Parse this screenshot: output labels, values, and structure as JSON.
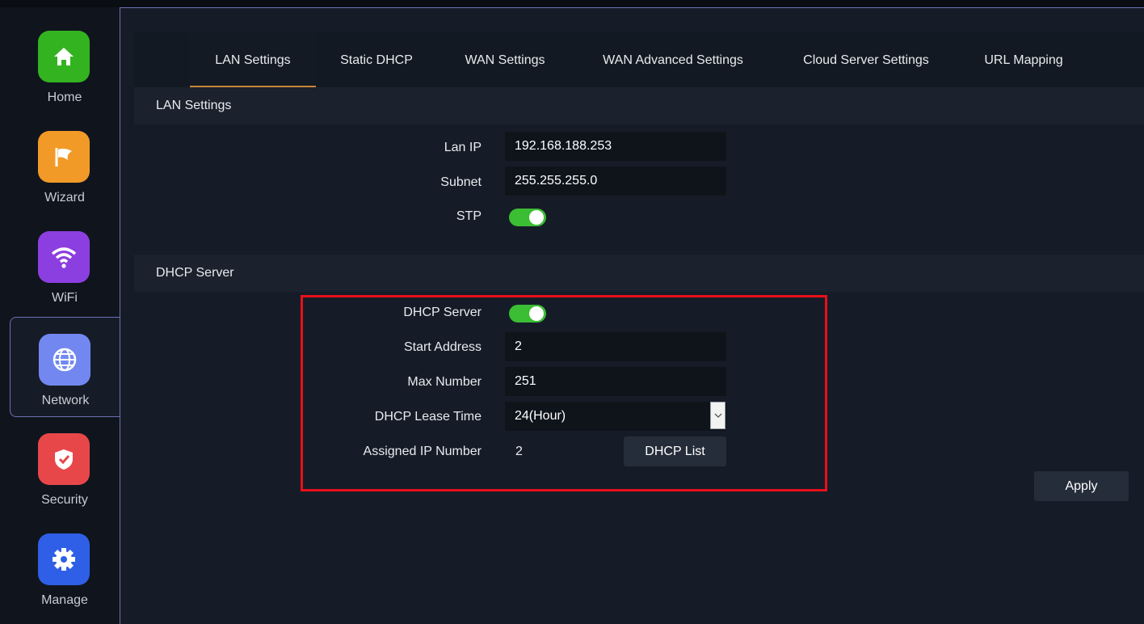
{
  "sidebar": {
    "items": [
      {
        "label": "Home",
        "icon": "home-icon",
        "color": "#33b320"
      },
      {
        "label": "Wizard",
        "icon": "flag-icon",
        "color": "#f29a28"
      },
      {
        "label": "WiFi",
        "icon": "wifi-icon",
        "color": "#8c3fe0"
      },
      {
        "label": "Network",
        "icon": "globe-icon",
        "color": "#7288f0",
        "active": true
      },
      {
        "label": "Security",
        "icon": "shield-icon",
        "color": "#e8474a"
      },
      {
        "label": "Manage",
        "icon": "gear-icon",
        "color": "#2f5fe6"
      }
    ]
  },
  "tabs": [
    {
      "label": "LAN Settings",
      "active": true
    },
    {
      "label": "Static DHCP"
    },
    {
      "label": "WAN Settings"
    },
    {
      "label": "WAN Advanced Settings"
    },
    {
      "label": "Cloud Server Settings"
    },
    {
      "label": "URL Mapping"
    }
  ],
  "lan": {
    "section_title": "LAN Settings",
    "lan_ip_label": "Lan IP",
    "lan_ip_value": "192.168.188.253",
    "subnet_label": "Subnet",
    "subnet_value": "255.255.255.0",
    "stp_label": "STP",
    "stp_enabled": true
  },
  "dhcp": {
    "section_title": "DHCP Server",
    "server_label": "DHCP Server",
    "server_enabled": true,
    "start_label": "Start Address",
    "start_value": "2",
    "max_label": "Max Number",
    "max_value": "251",
    "lease_label": "DHCP Lease Time",
    "lease_value": "24(Hour)",
    "assigned_label": "Assigned IP Number",
    "assigned_value": "2",
    "list_button": "DHCP List"
  },
  "apply_button": "Apply",
  "colors": {
    "accent_tab": "#c8843a",
    "toggle_on": "#3bbd34",
    "highlight": "#e8101a"
  }
}
